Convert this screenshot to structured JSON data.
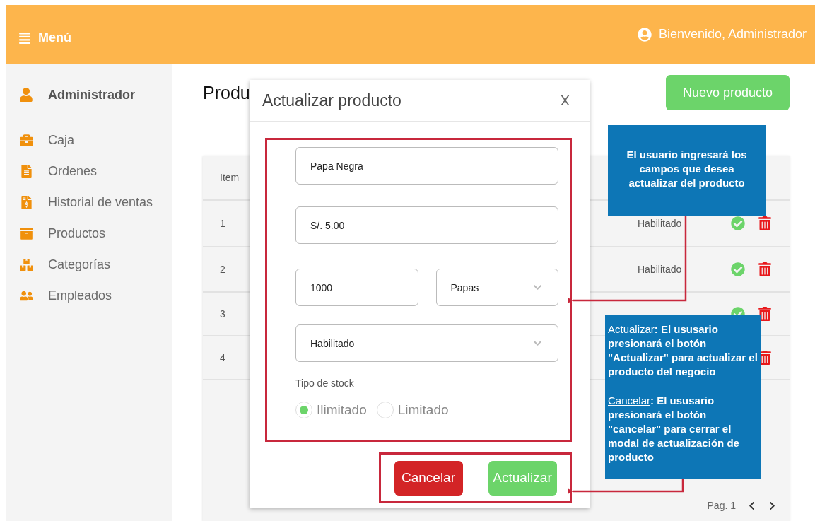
{
  "header": {
    "menu_label": "Menú",
    "greeting": "Bienvenido, Administrador"
  },
  "sidebar": {
    "user": "Administrador",
    "items": [
      {
        "label": "Caja"
      },
      {
        "label": "Ordenes"
      },
      {
        "label": "Historial de ventas"
      },
      {
        "label": "Productos"
      },
      {
        "label": "Categorías"
      },
      {
        "label": "Empleados"
      }
    ]
  },
  "page": {
    "title": "Produ",
    "new_button": "Nuevo producto"
  },
  "table": {
    "columns": [
      "Item"
    ],
    "rows": [
      {
        "item": "1",
        "status": "Habilitado",
        "check": true
      },
      {
        "item": "2",
        "status": "Habilitado",
        "check": true
      },
      {
        "item": "3",
        "check": true
      },
      {
        "item": "4",
        "check": false
      }
    ],
    "pagination": "Pag. 1"
  },
  "modal": {
    "title": "Actualizar producto",
    "close": "X",
    "field_rows": [
      [
        {
          "kind": "input",
          "value": "Papa Negra"
        }
      ],
      [
        {
          "kind": "input",
          "value": "S/. 5.00"
        }
      ],
      [
        {
          "kind": "input",
          "value": "1000"
        },
        {
          "kind": "select",
          "value": "Papas"
        }
      ],
      [
        {
          "kind": "select",
          "value": "Habilitado"
        }
      ]
    ],
    "stock_label": "Tipo de stock",
    "stock_options": [
      {
        "label": "Ilimitado",
        "selected": true
      },
      {
        "label": "Limitado",
        "selected": false
      }
    ],
    "cancel_button": "Cancelar",
    "confirm_button": "Actualizar"
  },
  "callouts": [
    {
      "paragraphs": [
        {
          "text": "El usuario ingresará los campos que desea actualizar del producto"
        }
      ]
    },
    {
      "paragraphs": [
        {
          "term": "Actualizar",
          "text": ": El ususario presionará el botón \"Actualizar\" para actualizar el producto del negocio"
        },
        {
          "term": "Cancelar",
          "text": ": El ususario presionará el botón \"cancelar\" para cerrar el modal de actualización de producto"
        }
      ]
    }
  ]
}
